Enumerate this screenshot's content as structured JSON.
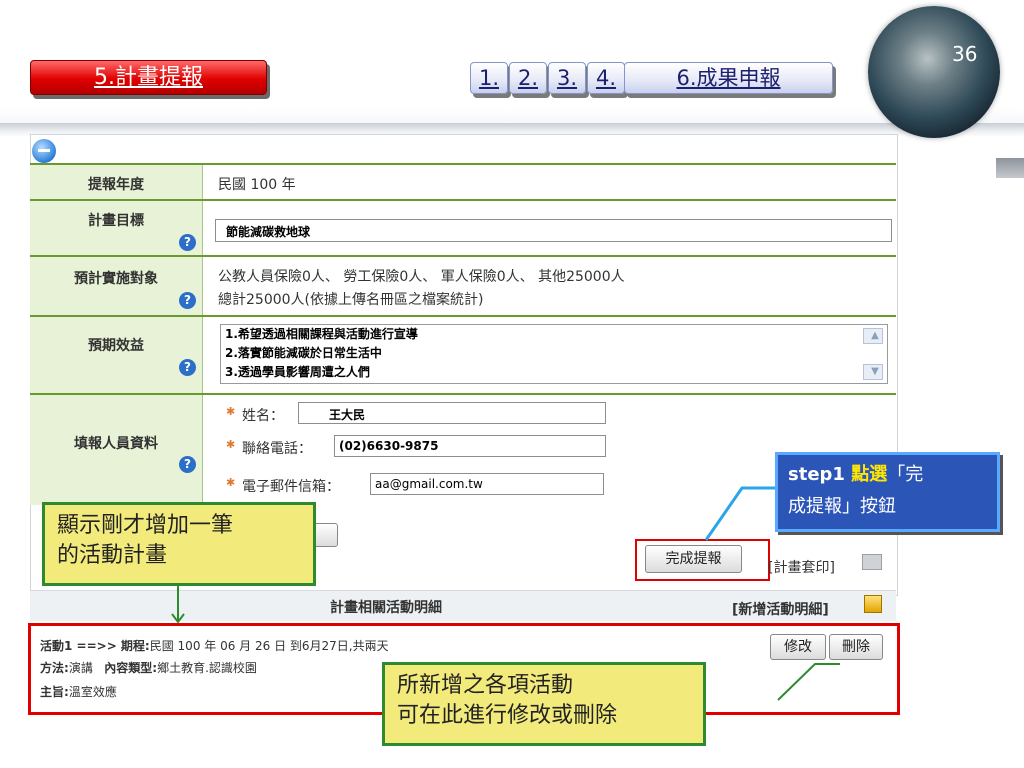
{
  "slide_number": "36",
  "title_tab": "5.計畫提報",
  "nav_tabs": [
    "1.",
    "2.",
    "3.",
    "4.",
    "6.成果申報"
  ],
  "form": {
    "year": {
      "label": "提報年度",
      "value": "民國 100 年"
    },
    "goal": {
      "label": "計畫目標",
      "value": "節能減碳救地球"
    },
    "target": {
      "label": "預計實施對象",
      "line1": "公教人員保險0人、 勞工保險0人、 軍人保險0人、 其他25000人",
      "line2": "總計25000人(依據上傳名冊區之檔案統計)"
    },
    "benefit": {
      "label": "預期效益",
      "lines": [
        "1.希望透過相關課程與活動進行宣導",
        "2.落實節能減碳於日常生活中",
        "3.透過學員影響周遭之人們"
      ]
    },
    "reporter": {
      "label": "填報人員資料",
      "name_label": "姓名：",
      "name_value": "王大民",
      "phone_label": "聯絡電話：",
      "phone_value": "(02)6630-9875",
      "email_label": "電子郵件信箱：",
      "email_value": "aa@gmail.com.tw"
    }
  },
  "buttons": {
    "complete": "完成提報",
    "print": "[計畫套印]",
    "add_detail": "[新增活動明細]",
    "edit": "修改",
    "delete": "刪除"
  },
  "activity_header": "計畫相關活動明細",
  "activity": {
    "line1_prefix": "活動1 ==>> 期程:",
    "line1_value": "民國 100 年 06 月 26 日  到6月27日,共兩天",
    "method_label": "方法:",
    "method_value": "演講",
    "type_label": "內容類型:",
    "type_value": "鄉土教育.認識校園",
    "theme_label": "主旨:",
    "theme_value": "溫室效應"
  },
  "callouts": {
    "step1_a": "step1 ",
    "step1_b": "點選",
    "step1_c": "「完",
    "step1_d": "成提報」按鈕",
    "show_plan_1": "顯示剛才增加一筆",
    "show_plan_2": "的活動計畫",
    "edit_delete_1": "所新增之各項活動",
    "edit_delete_2": "可在此進行修改或刪除"
  },
  "colors": {
    "accent_green": "#2d8b2d",
    "highlight_red": "#e00000",
    "callout_blue": "#2c55b8",
    "callout_yellow": "#f2eb7b"
  }
}
